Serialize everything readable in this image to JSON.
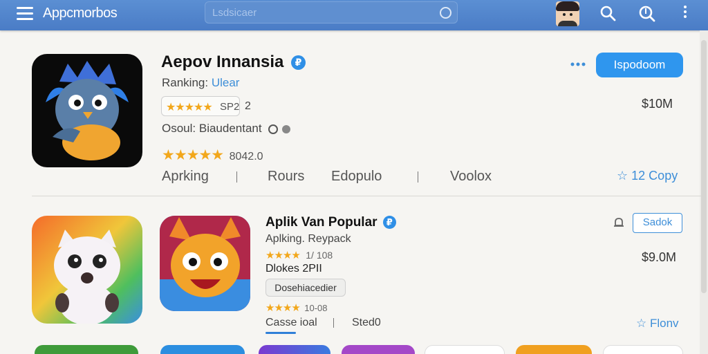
{
  "header": {
    "brand": "Appcmorbos",
    "search_placeholder": "Lsdsicaer"
  },
  "featured_app": {
    "title": "Aepov Innansia",
    "verified_glyph": "₽",
    "ranking_label": "Ranking:",
    "ranking_value": "Ulear",
    "rating_badge_text": "SP2",
    "rating_badge_count": "2",
    "developer": "Osoul: Biaudentant",
    "rating_value": "8042.0",
    "price": "$10M",
    "install_button": "Ispodoom",
    "tabs": [
      "Aprking",
      "Rours",
      "Edopulo",
      "Voolox"
    ],
    "copy_link": "12 Copy"
  },
  "second_app": {
    "title": "Aplik Van Popular",
    "subtitle": "Aplking. Reypack",
    "rating_value": "1/ 108",
    "developer": "Dlokes 2PII",
    "tag": "Dosehiacedier",
    "rating_value_2": "10-08",
    "price": "$9.0M",
    "select_button": "Sadok",
    "tabs": [
      "Casse ioal",
      "Sted0"
    ],
    "follow_link": "Flonv"
  },
  "colors": {
    "topbar": "#4a7cc6",
    "accent": "#2f96ee",
    "star": "#f2a71b",
    "background": "#f6f5f2"
  },
  "icons": [
    "menu-icon",
    "search-icon",
    "alt-search-icon",
    "more-icon",
    "verified-icon",
    "star-icon",
    "bookmark-icon",
    "bell-icon",
    "dots-icon"
  ]
}
